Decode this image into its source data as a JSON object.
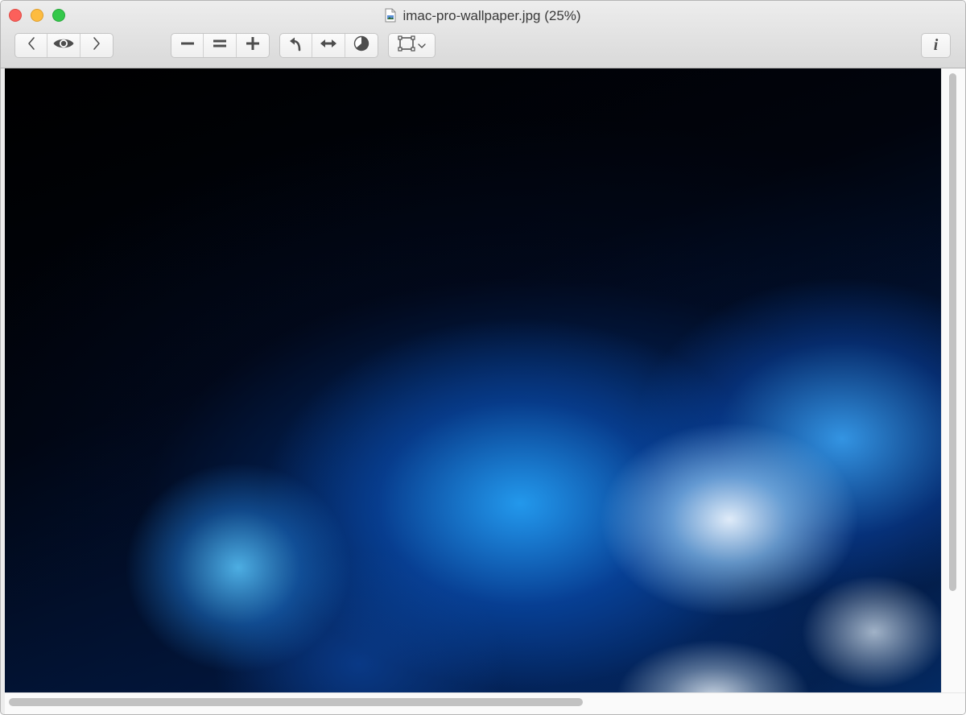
{
  "window": {
    "title": "imac-pro-wallpaper.jpg (25%)",
    "file_icon": "jpeg-document-icon"
  },
  "window_controls": {
    "close": {
      "icon": "close-circle",
      "color": "#fc605b"
    },
    "minimize": {
      "icon": "minimize-circle",
      "color": "#fdbc40"
    },
    "zoom": {
      "icon": "zoom-circle",
      "color": "#34c84a"
    }
  },
  "toolbar": {
    "navigation": {
      "previous_icon": "chevron-left-icon",
      "quick_look_icon": "eye-icon",
      "next_icon": "chevron-right-icon"
    },
    "zoom": {
      "zoom_out_icon": "minus-icon",
      "actual_size_icon": "equals-icon",
      "zoom_in_icon": "plus-icon"
    },
    "edit": {
      "rotate_icon": "rotate-left-arrow-icon",
      "flip_icon": "horizontal-double-arrow-icon",
      "adjust_color_icon": "contrast-circle-icon"
    },
    "selection": {
      "select_icon": "rectangular-selection-icon",
      "dropdown_icon": "chevron-down-icon"
    },
    "info": {
      "label": "i",
      "icon": "info-icon"
    }
  },
  "content": {
    "image": "blue-cloud-smoke-wallpaper",
    "zoom_percent": 25
  },
  "scrollbars": {
    "vertical_thumb_fraction": 0.83,
    "horizontal_thumb_fraction": 0.61
  },
  "colors": {
    "titlebar": "#e3e3e3",
    "button_icon": "#4d4d4d",
    "scroll_thumb": "#c2c2c2"
  }
}
